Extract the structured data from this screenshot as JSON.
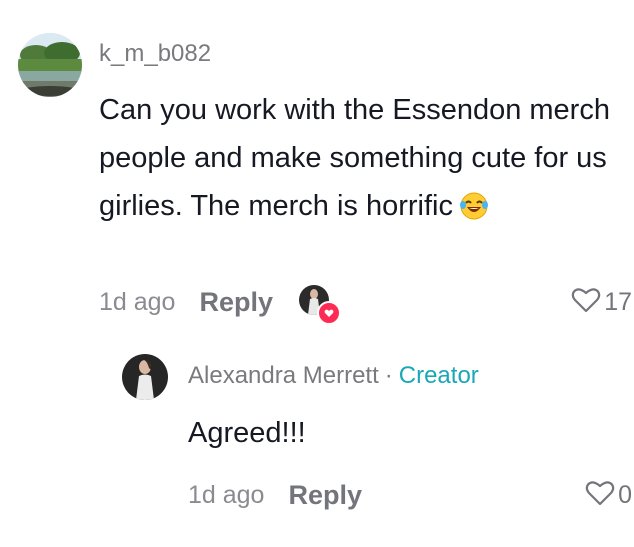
{
  "comments": [
    {
      "username": "k_m_b082",
      "text": "Can you work with the Essendon merch people and make something cute for us girlies. The merch is horrific",
      "emoji_icon": "laughing-tears-emoji",
      "time_ago": "1d ago",
      "reply_label": "Reply",
      "like_count": "17",
      "creator_liked": true
    },
    {
      "username": "Alexandra Merrett",
      "separator": "·",
      "badge": "Creator",
      "text": "Agreed!!!",
      "time_ago": "1d ago",
      "reply_label": "Reply",
      "like_count": "0"
    }
  ],
  "colors": {
    "username": "#7a7a7e",
    "creator_badge": "#1aa8b8",
    "heart_badge": "#fe2c55",
    "text": "#161823"
  }
}
